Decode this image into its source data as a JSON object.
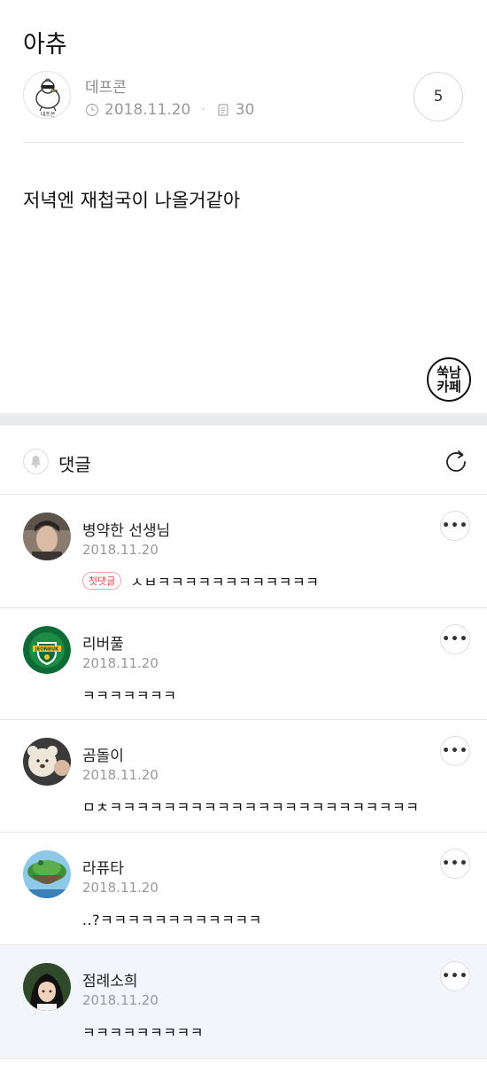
{
  "post": {
    "title": "아츄",
    "author": "데프콘",
    "date": "2018.11.20",
    "views": "30",
    "comment_count": "5",
    "body": "저녁엔 재첩국이 나올거같아",
    "stamp_line1": "쑥남",
    "stamp_line2": "카페"
  },
  "comments_section": {
    "title": "댓글"
  },
  "comments": [
    {
      "name": "병약한 선생님",
      "date": "2018.11.20",
      "badge": "첫댓글",
      "text": "ㅅㅂㅋㅋㅋㅋㅋㅋㅋㅋㅋㅋㅋㅋ",
      "avatar": "portrait-man"
    },
    {
      "name": "리버풀",
      "date": "2018.11.20",
      "text": "ㅋㅋㅋㅋㅋㅋㅋ",
      "avatar": "jeonbuk-logo",
      "avatar_text": "JEONBUK"
    },
    {
      "name": "곰돌이",
      "date": "2018.11.20",
      "text": "ㅁㅊㅋㅋㅋㅋㅋㅋㅋㅋㅋㅋㅋㅋㅋㅋㅋㅋㅋㅋㅋㅋㅋㅋㅋ",
      "avatar": "teddy-bear"
    },
    {
      "name": "라퓨타",
      "date": "2018.11.20",
      "text": "..?ㅋㅋㅋㅋㅋㅋㅋㅋㅋㅋㅋㅋ",
      "avatar": "floating-island"
    },
    {
      "name": "점례소희",
      "date": "2018.11.20",
      "text": "ㅋㅋㅋㅋㅋㅋㅋㅋㅋ",
      "avatar": "anime-girl"
    }
  ],
  "colors": {
    "badge_red": "#e8464a",
    "divider": "#e6e6e6",
    "section_gap": "#e9eaec",
    "highlight_row": "#f2f5fa"
  }
}
